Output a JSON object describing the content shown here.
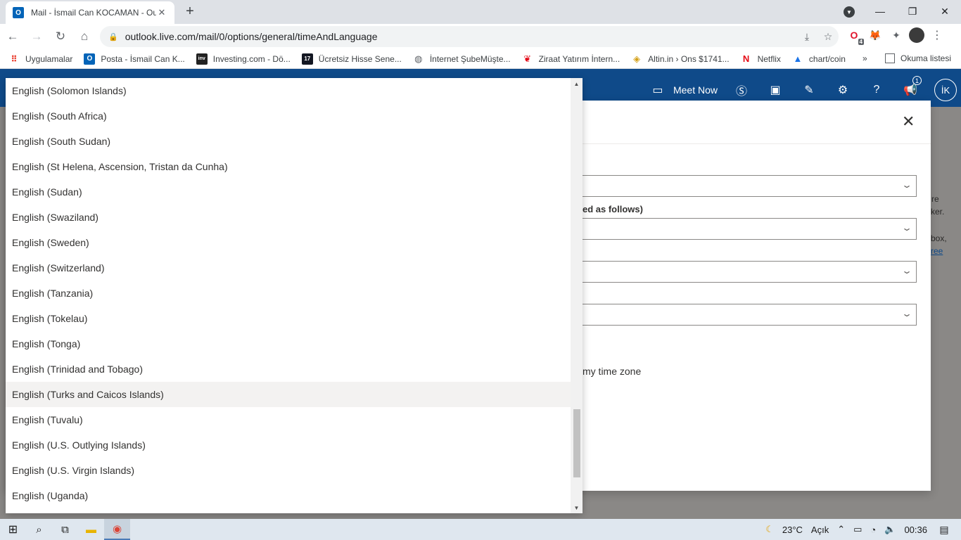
{
  "browser": {
    "tab_title": "Mail - İsmail Can KOCAMAN - Ou",
    "tab_favicon": "O",
    "url": "outlook.live.com/mail/0/options/general/timeAndLanguage",
    "extension_badge": "4"
  },
  "bookmarks": {
    "items": [
      {
        "label": "Uygulamalar",
        "icon": "apps-grid",
        "color": "#ea4335"
      },
      {
        "label": "Posta - İsmail Can K...",
        "icon": "O",
        "color": "#0364b8"
      },
      {
        "label": "Investing.com - Dö...",
        "icon": "inv",
        "color": "#222222"
      },
      {
        "label": "Ücretsiz Hisse Sene...",
        "icon": "TV",
        "color": "#131722"
      },
      {
        "label": "İnternet ŞubeMüşte...",
        "icon": "globe",
        "color": "#5f6368"
      },
      {
        "label": "Ziraat Yatırım İntern...",
        "icon": "Z",
        "color": "#e30a17"
      },
      {
        "label": "Altin.in › Ons $1741...",
        "icon": "A",
        "color": "#d4a017"
      },
      {
        "label": "Netflix",
        "icon": "N",
        "color": "#e50914"
      },
      {
        "label": "chart/coin",
        "icon": "A",
        "color": "#1a73e8"
      }
    ],
    "more": "»",
    "reading_list": "Okuma listesi"
  },
  "outlook": {
    "meet_now": "Meet Now",
    "notification_count": "1",
    "avatar_initials": "İK",
    "header_color": "#0f4a89"
  },
  "background_text": {
    "line1": "re",
    "line2": "ker.",
    "line3": "box,",
    "line4": "ree"
  },
  "dialog": {
    "label_format": "ed as follows)",
    "time_zone_text": "my time zone"
  },
  "dropdown": {
    "items": [
      "English (Solomon Islands)",
      "English (South Africa)",
      "English (South Sudan)",
      "English (St Helena, Ascension, Tristan da Cunha)",
      "English (Sudan)",
      "English (Swaziland)",
      "English (Sweden)",
      "English (Switzerland)",
      "English (Tanzania)",
      "English (Tokelau)",
      "English (Tonga)",
      "English (Trinidad and Tobago)",
      "English (Turks and Caicos Islands)",
      "English (Tuvalu)",
      "English (U.S. Outlying Islands)",
      "English (U.S. Virgin Islands)",
      "English (Uganda)"
    ],
    "hovered_index": 12
  },
  "taskbar": {
    "weather": "23°C",
    "weather_desc": "Açık",
    "time": "00:36"
  }
}
